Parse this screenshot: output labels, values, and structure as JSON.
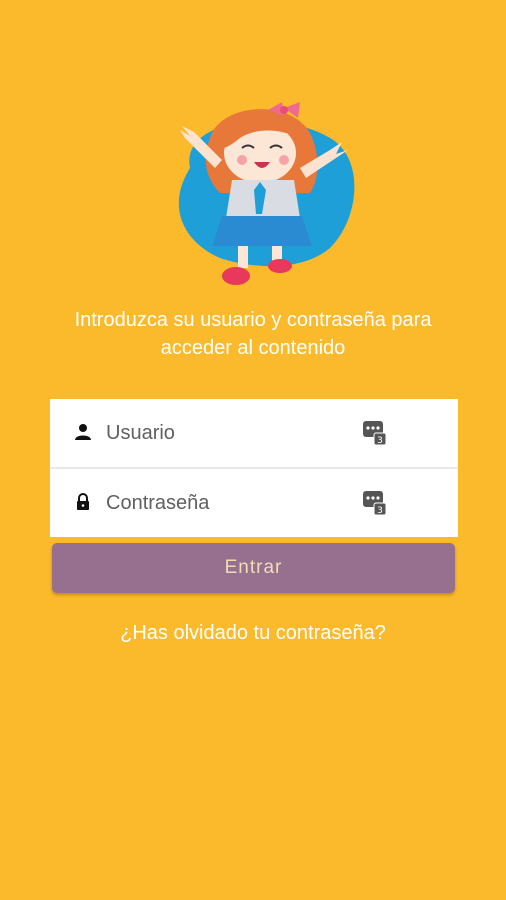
{
  "app": {
    "background_color": "#FBBA2B",
    "mascot_icon": "girl-mascot-icon"
  },
  "intro": {
    "line1": "Introduzca su usuario y contraseña para",
    "line2": "acceder al contenido"
  },
  "form": {
    "username": {
      "placeholder": "Usuario",
      "value": "",
      "icon": "person-icon",
      "keypad_icon": "keypad-icon"
    },
    "password": {
      "placeholder": "Contraseña",
      "value": "",
      "icon": "lock-icon",
      "keypad_icon": "keypad-icon"
    }
  },
  "actions": {
    "enter_label": "Entrar",
    "enter_color": "#98708F",
    "forgot_label": "¿Has olvidado tu contraseña?"
  }
}
